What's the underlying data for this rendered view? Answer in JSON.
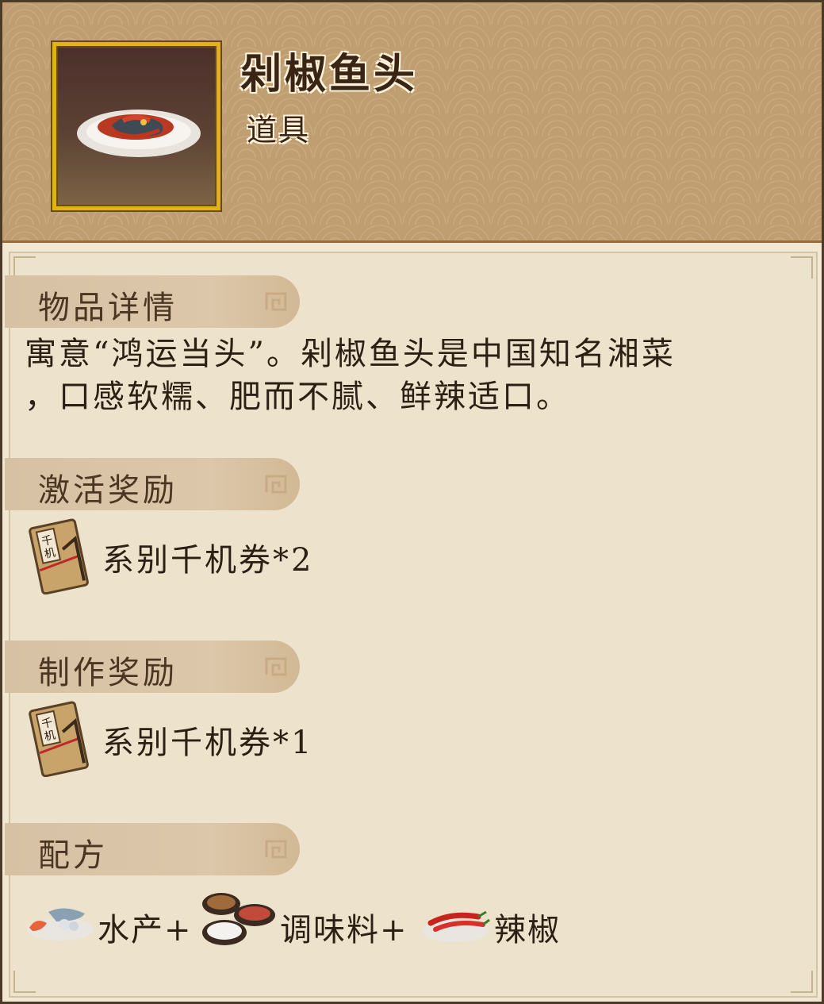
{
  "item": {
    "name": "剁椒鱼头",
    "type": "道具",
    "icon": "fish-head-dish-icon"
  },
  "sections": {
    "details": {
      "title": "物品详情",
      "text_line1": "寓意“鸿运当头”。剁椒鱼头是中国知名湘菜",
      "text_line2": "，口感软糯、肥而不腻、鲜辣适口。"
    },
    "activation_reward": {
      "title": "激活奖励",
      "reward": "系别千机券*2",
      "icon": "qianji-ticket-icon"
    },
    "crafting_reward": {
      "title": "制作奖励",
      "reward": "系别千机券*1",
      "icon": "qianji-ticket-icon"
    },
    "recipe": {
      "title": "配方",
      "ingredients": [
        {
          "label": "水产+",
          "icon": "seafood-plate-icon"
        },
        {
          "label": "调味料+",
          "icon": "seasoning-bowls-icon"
        },
        {
          "label": "辣椒",
          "icon": "chili-plate-icon"
        }
      ]
    }
  },
  "colors": {
    "frame_gold": "#e1b317",
    "header_bg": "#bf9f72",
    "content_bg": "#ede3cd"
  }
}
